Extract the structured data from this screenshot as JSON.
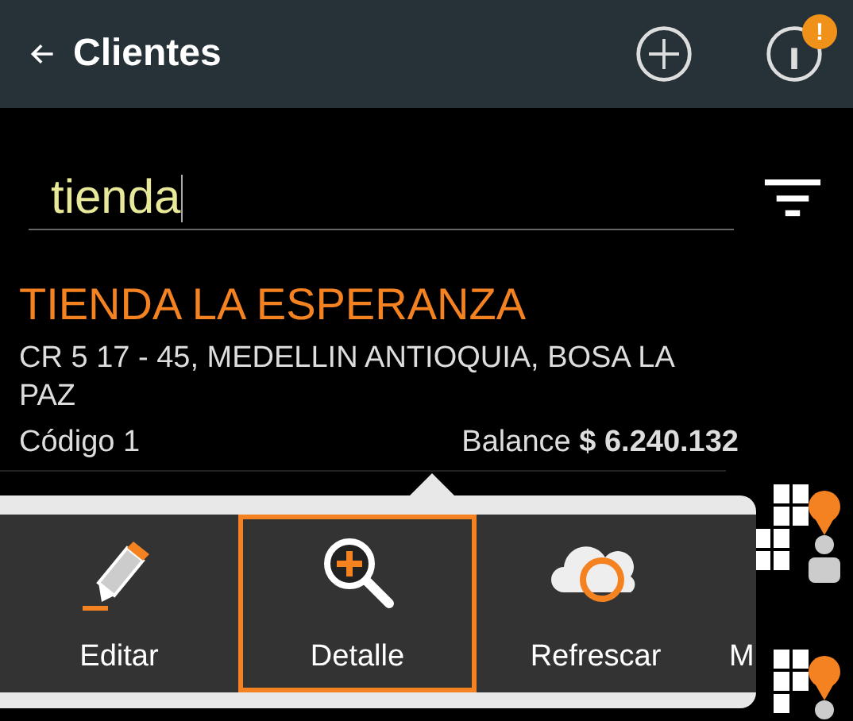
{
  "app_bar": {
    "title": "Clientes",
    "alert_badge": "!"
  },
  "search": {
    "value": "tienda"
  },
  "clients": [
    {
      "name": "TIENDA LA ESPERANZA",
      "address": "CR 5 17 - 45, MEDELLIN ANTIOQUIA, BOSA LA PAZ",
      "code": "Código 1",
      "balance_label": "Balance",
      "balance": "$ 6.240.132"
    }
  ],
  "actions": [
    {
      "kind": "edit",
      "label": "Editar",
      "selected": false
    },
    {
      "kind": "detail",
      "label": "Detalle",
      "selected": true
    },
    {
      "kind": "refresh",
      "label": "Refrescar",
      "selected": false
    },
    {
      "kind": "more",
      "label": "M",
      "selected": false
    }
  ]
}
